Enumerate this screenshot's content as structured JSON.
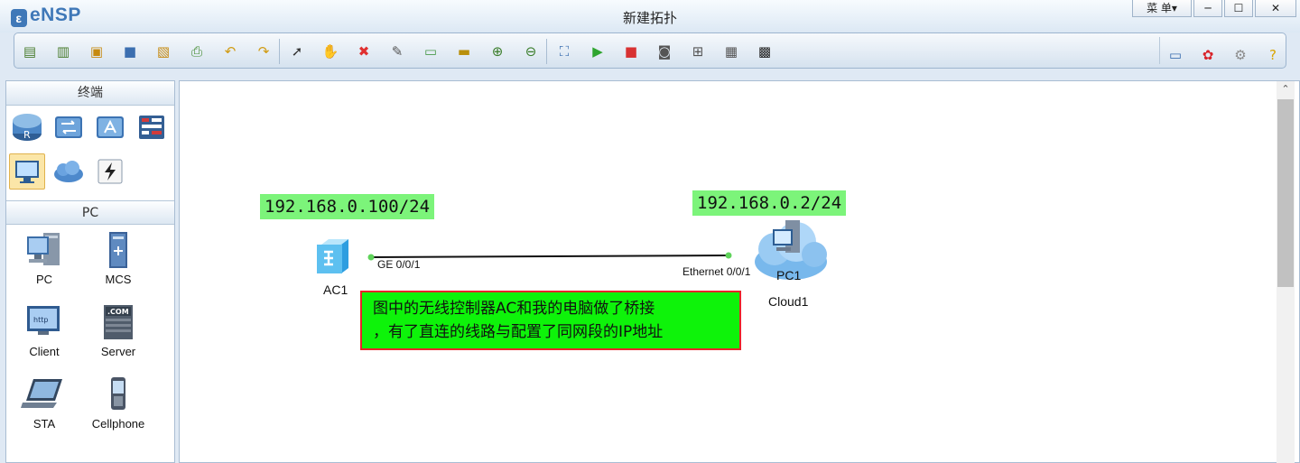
{
  "app": {
    "logo": "eNSP",
    "window_title": "新建拓扑"
  },
  "window_controls": {
    "menu_label": "菜 单▾",
    "minimize": "─",
    "maximize": "☐",
    "close": "✕"
  },
  "toolbar": {
    "left_icons": [
      "new-topology-icon",
      "new-example-icon",
      "open-icon",
      "save-icon",
      "save-as-icon",
      "print-icon",
      "undo-icon",
      "redo-icon",
      "select-pointer-icon",
      "pan-hand-icon",
      "delete-icon",
      "delete-link-icon",
      "add-text-icon",
      "palette-icon",
      "zoom-in-icon",
      "zoom-out-icon",
      "fit-view-icon",
      "start-device-icon",
      "stop-device-icon",
      "capture-icon",
      "topology-icon",
      "grid-icon",
      "screenshot-icon"
    ],
    "right_icons": [
      "chat-icon",
      "huawei-logo-icon",
      "settings-icon",
      "help-icon"
    ]
  },
  "sidebar": {
    "category_title": "终端",
    "categories": [
      "router-icon",
      "switch-icon",
      "wlan-icon",
      "firewall-icon",
      "pc-terminal-icon",
      "cloud-icon",
      "link-icon"
    ],
    "device_title": "PC",
    "devices": [
      {
        "label": "PC",
        "icon": "pc-icon"
      },
      {
        "label": "MCS",
        "icon": "mcs-icon"
      },
      {
        "label": "Client",
        "icon": "client-icon"
      },
      {
        "label": "Server",
        "icon": "server-icon"
      },
      {
        "label": "STA",
        "icon": "sta-icon"
      },
      {
        "label": "Cellphone",
        "icon": "cellphone-icon"
      }
    ]
  },
  "topology": {
    "ip_left": "192.168.0.100/24",
    "ip_right": "192.168.0.2/24",
    "ac_name": "AC1",
    "ac_port": "GE 0/0/1",
    "cloud_name": "Cloud1",
    "cloud_inner": "PC1",
    "cloud_port": "Ethernet 0/0/1",
    "note_line1": "图中的无线控制器AC和我的电脑做了桥接",
    "note_line2": "，有了直连的线路与配置了同网段的IP地址"
  },
  "colors": {
    "ip_label_bg": "#7cf47a",
    "note_bg": "#0ef30a",
    "note_border": "#e8242a",
    "link_dot": "#5fd35a"
  }
}
